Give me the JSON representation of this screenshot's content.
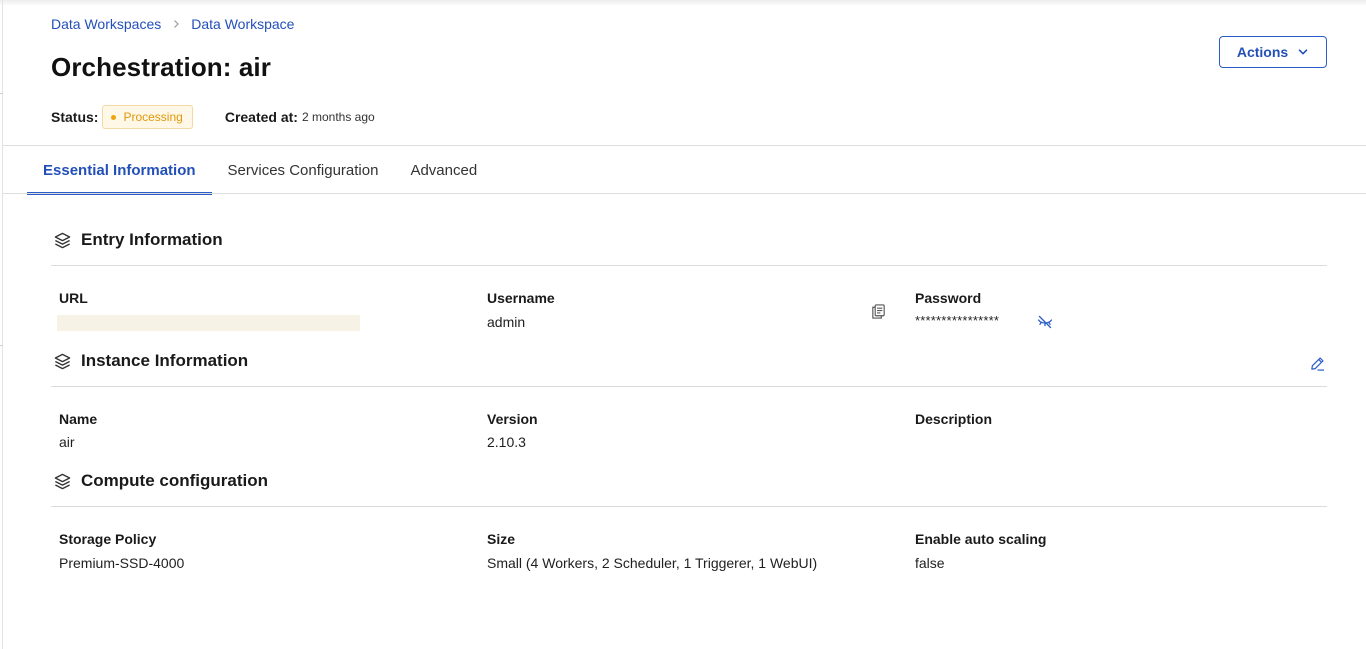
{
  "breadcrumb": {
    "items": [
      "Data Workspaces",
      "Data Workspace"
    ]
  },
  "page": {
    "title": "Orchestration: air",
    "actions_label": "Actions"
  },
  "status": {
    "label": "Status:",
    "value": "Processing",
    "created_label": "Created at:",
    "created_value": "2 months ago"
  },
  "tabs": [
    {
      "label": "Essential Information",
      "active": true
    },
    {
      "label": "Services Configuration",
      "active": false
    },
    {
      "label": "Advanced",
      "active": false
    }
  ],
  "entry_information": {
    "title": "Entry Information",
    "url_label": "URL",
    "url_value": "",
    "username_label": "Username",
    "username_value": "admin",
    "password_label": "Password",
    "password_value": "****************"
  },
  "instance_information": {
    "title": "Instance Information",
    "name_label": "Name",
    "name_value": "air",
    "version_label": "Version",
    "version_value": "2.10.3",
    "description_label": "Description",
    "description_value": ""
  },
  "compute_configuration": {
    "title": "Compute configuration",
    "storage_label": "Storage Policy",
    "storage_value": "Premium-SSD-4000",
    "size_label": "Size",
    "size_value": "Small (4 Workers, 2 Scheduler, 1 Triggerer, 1 WebUI)",
    "autoscale_label": "Enable auto scaling",
    "autoscale_value": "false"
  },
  "colors": {
    "accent": "#2b5cc7",
    "link": "#2350b8",
    "status_warning": "#f0a20d",
    "status_warning_bg": "#fff8e7"
  },
  "icons": [
    "chevron-right-icon",
    "chevron-down-icon",
    "layers-icon",
    "copy-icon",
    "eye-off-icon",
    "pencil-icon"
  ]
}
